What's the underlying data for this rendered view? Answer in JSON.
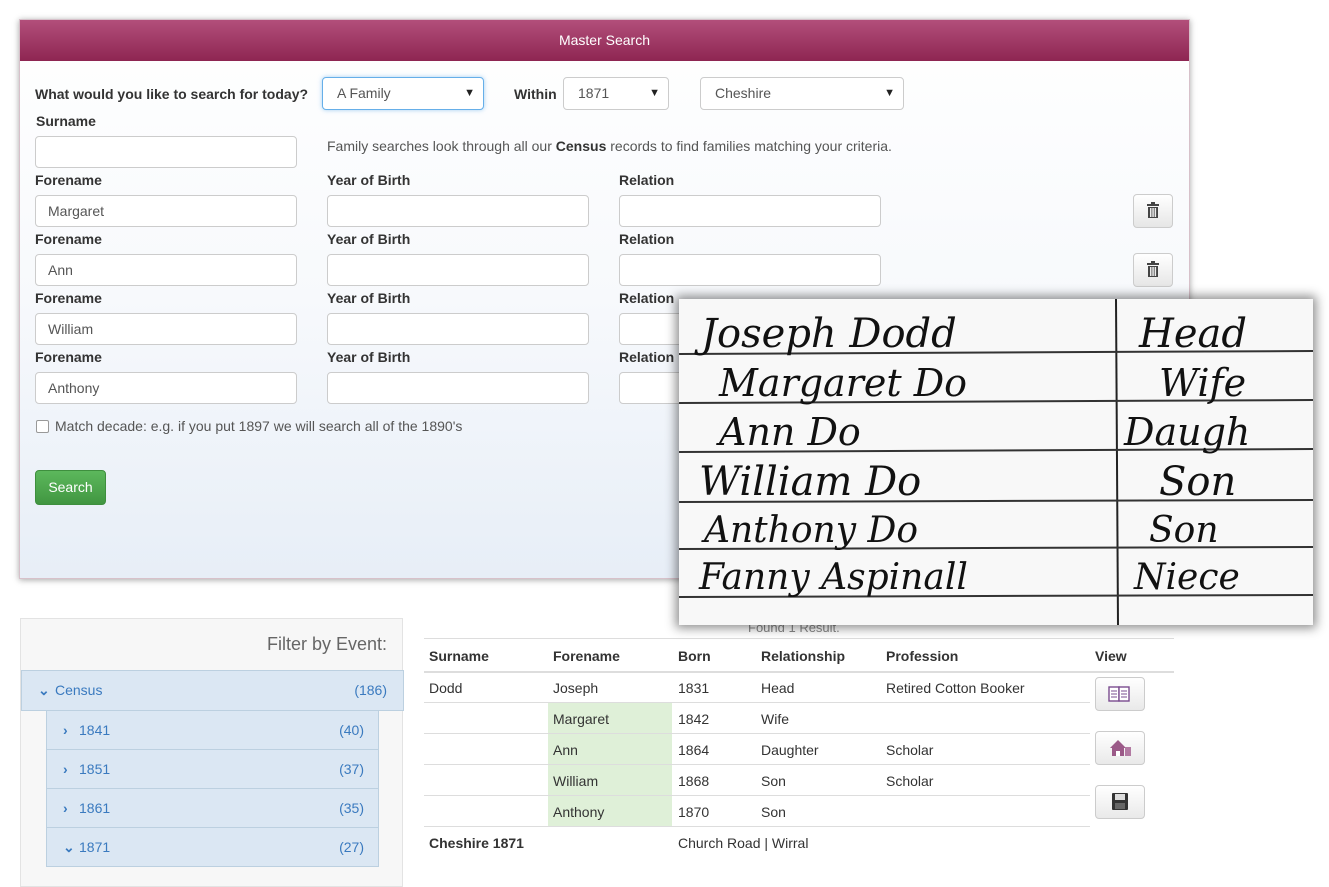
{
  "panel": {
    "title": "Master Search"
  },
  "search": {
    "question": "What would you like to search for today?",
    "type_value": "A Family",
    "within_label": "Within",
    "year_value": "1871",
    "county_value": "Cheshire",
    "surname_label": "Surname",
    "surname_value": "",
    "info_prefix": "Family searches look through all our ",
    "info_bold": "Census",
    "info_suffix": " records to find families matching your criteria.",
    "forename_label": "Forename",
    "yob_label": "Year of Birth",
    "relation_label": "Relation",
    "rows": [
      {
        "forename": "Margaret",
        "year": "",
        "relation": ""
      },
      {
        "forename": "Ann",
        "year": "",
        "relation": ""
      },
      {
        "forename": "William",
        "year": "",
        "relation": ""
      },
      {
        "forename": "Anthony",
        "year": "",
        "relation": ""
      }
    ],
    "match_decade": "Match decade: e.g. if you put 1897 we will search all of the 1890's",
    "search_button": "Search"
  },
  "overlay": {
    "rows": [
      {
        "name": "Joseph Dodd",
        "rel": "Head"
      },
      {
        "name": "Margaret Do",
        "rel": "Wife"
      },
      {
        "name": "Ann Do",
        "rel": "Daugh"
      },
      {
        "name": "William Do",
        "rel": "Son"
      },
      {
        "name": "Anthony Do",
        "rel": "Son"
      },
      {
        "name": "Fanny Aspinall",
        "rel": "Niece"
      }
    ]
  },
  "filter": {
    "title": "Filter by Event:",
    "census": {
      "label": "Census",
      "count": "(186)"
    },
    "years": [
      {
        "label": "1841",
        "count": "(40)"
      },
      {
        "label": "1851",
        "count": "(37)"
      },
      {
        "label": "1861",
        "count": "(35)"
      },
      {
        "label": "1871",
        "count": "(27)"
      }
    ]
  },
  "results": {
    "found": "Found 1 Result.",
    "headers": [
      "Surname",
      "Forename",
      "Born",
      "Relationship",
      "Profession",
      "View"
    ],
    "rows": [
      {
        "surname": "Dodd",
        "forename": "Joseph",
        "born": "1831",
        "relationship": "Head",
        "profession": "Retired Cotton Booker"
      },
      {
        "surname": "",
        "forename": "Margaret",
        "born": "1842",
        "relationship": "Wife",
        "profession": ""
      },
      {
        "surname": "",
        "forename": "Ann",
        "born": "1864",
        "relationship": "Daughter",
        "profession": "Scholar"
      },
      {
        "surname": "",
        "forename": "William",
        "born": "1868",
        "relationship": "Son",
        "profession": "Scholar"
      },
      {
        "surname": "",
        "forename": "Anthony",
        "born": "1870",
        "relationship": "Son",
        "profession": ""
      }
    ],
    "footer_place": "Cheshire 1871",
    "footer_address": "Church Road | Wirral"
  },
  "colors": {
    "header": "#9c3463",
    "link": "#3a7abf",
    "success": "#5cb85c",
    "match": "#dff0d8"
  }
}
